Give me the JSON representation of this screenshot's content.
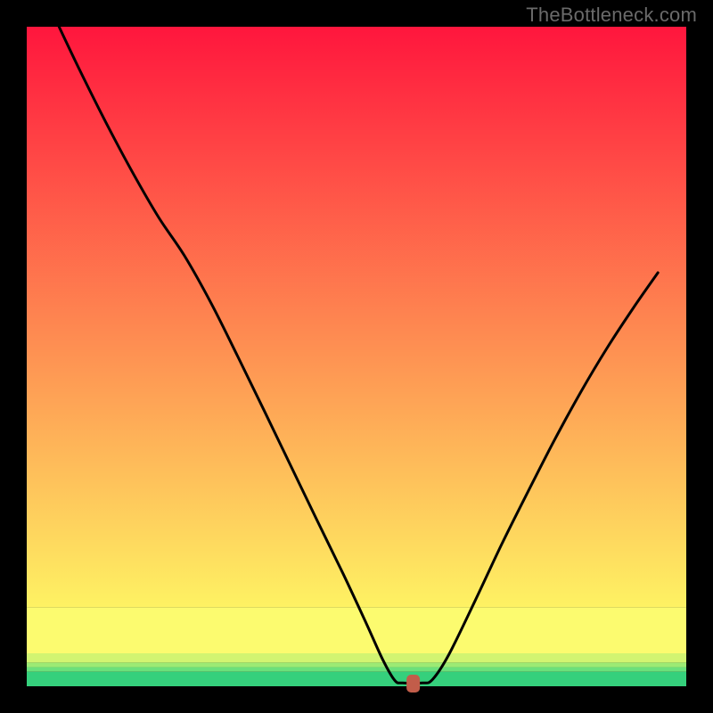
{
  "watermark": "TheBottleneck.com",
  "chart_data": {
    "type": "line",
    "title": "",
    "xlabel": "",
    "ylabel": "",
    "xlim": [
      0,
      100
    ],
    "ylim": [
      0,
      100
    ],
    "marker": {
      "x": 58.6,
      "y": 0,
      "color": "#c25d4a"
    },
    "background_bands": [
      {
        "y_from": 0,
        "y_to": 2.2,
        "color": "#35d07c"
      },
      {
        "y_from": 2.2,
        "y_to": 2.9,
        "color": "#6be07b"
      },
      {
        "y_from": 2.9,
        "y_to": 3.6,
        "color": "#9cea74"
      },
      {
        "y_from": 3.6,
        "y_to": 5.0,
        "color": "#d2f471"
      },
      {
        "y_from": 5.0,
        "y_to": 12.0,
        "color": "#fcfb6f"
      },
      {
        "y_from": 12.0,
        "y_to": 100,
        "gradient": [
          "#fef263",
          "#ff163d"
        ]
      }
    ],
    "series": [
      {
        "name": "bottleneck-curve",
        "color": "#000000",
        "points": [
          {
            "x": 4.9,
            "y": 100.0
          },
          {
            "x": 8.0,
            "y": 93.5
          },
          {
            "x": 12.0,
            "y": 85.5
          },
          {
            "x": 16.0,
            "y": 78.0
          },
          {
            "x": 20.0,
            "y": 71.1
          },
          {
            "x": 23.9,
            "y": 65.3
          },
          {
            "x": 28.0,
            "y": 58.0
          },
          {
            "x": 32.0,
            "y": 50.0
          },
          {
            "x": 36.0,
            "y": 41.8
          },
          {
            "x": 40.0,
            "y": 33.5
          },
          {
            "x": 44.0,
            "y": 25.2
          },
          {
            "x": 48.0,
            "y": 17.0
          },
          {
            "x": 51.5,
            "y": 9.5
          },
          {
            "x": 54.0,
            "y": 4.0
          },
          {
            "x": 55.8,
            "y": 0.9
          },
          {
            "x": 57.0,
            "y": 0.5
          },
          {
            "x": 60.0,
            "y": 0.5
          },
          {
            "x": 61.5,
            "y": 1.0
          },
          {
            "x": 64.0,
            "y": 4.8
          },
          {
            "x": 68.0,
            "y": 13.0
          },
          {
            "x": 72.0,
            "y": 21.5
          },
          {
            "x": 76.0,
            "y": 29.5
          },
          {
            "x": 80.0,
            "y": 37.3
          },
          {
            "x": 84.0,
            "y": 44.6
          },
          {
            "x": 88.0,
            "y": 51.3
          },
          {
            "x": 92.0,
            "y": 57.4
          },
          {
            "x": 95.7,
            "y": 62.7
          }
        ]
      }
    ]
  }
}
